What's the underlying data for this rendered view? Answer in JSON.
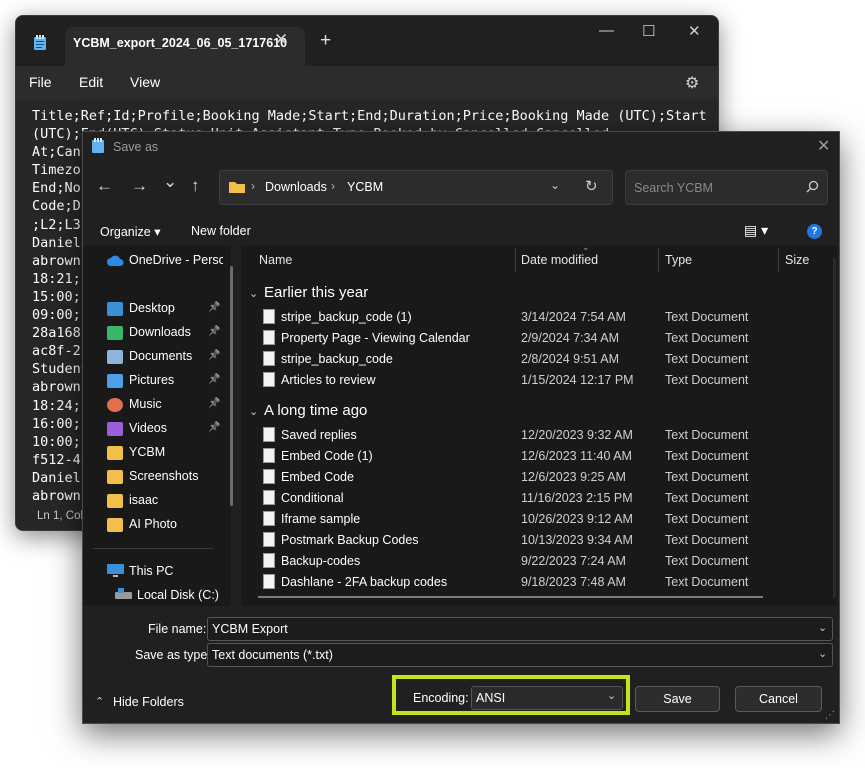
{
  "notepad": {
    "tab_title": "YCBM_export_2024_06_05_1717610",
    "tab_close": "✕",
    "new_tab": "+",
    "window_controls": {
      "minimize": "—",
      "maximize": "☐",
      "close": "✕"
    },
    "menu": [
      "File",
      "Edit",
      "View"
    ],
    "settings_icon": "gear-icon",
    "text_lines": [
      "Title;Ref;Id;Profile;Booking Made;Start;End;Duration;Price;Booking Made (UTC);Start",
      "(UTC);End(UTC);Status;Unit;Assistant;Type;Booked by;Cancelled;Cancelled",
      "At;Canc",
      "Timezo",
      "End;No",
      "Code;D",
      ";L2;L3",
      "Daniel",
      "abrown",
      "18:21;",
      "15:00;",
      "09:00;",
      "28a168",
      "ac8f-2",
      "Student",
      "abrown",
      "18:24;",
      "16:00;",
      "10:00;",
      "f512-4",
      "Daniel",
      "abrown"
    ],
    "status": "Ln 1, Col"
  },
  "dialog": {
    "title": "Save as",
    "close": "✕",
    "nav": {
      "back": "←",
      "forward": "→",
      "recent": "⌄",
      "up": "↑"
    },
    "breadcrumb": [
      "Downloads",
      "YCBM"
    ],
    "breadcrumb_sep": "›",
    "refresh": "↻",
    "search_placeholder": "Search YCBM",
    "toolbar": {
      "organize": "Organize ▾",
      "new_folder": "New folder",
      "view": "▤ ▾",
      "help": "?"
    },
    "sidebar": {
      "onedrive": "OneDrive - Person",
      "quick": [
        {
          "label": "Desktop",
          "pinned": true,
          "icon": "desktop-icon",
          "color": "#3a8fd9"
        },
        {
          "label": "Downloads",
          "pinned": true,
          "icon": "download-icon",
          "color": "#3ab56a"
        },
        {
          "label": "Documents",
          "pinned": true,
          "icon": "documents-icon",
          "color": "#8fb4d9"
        },
        {
          "label": "Pictures",
          "pinned": true,
          "icon": "pictures-icon",
          "color": "#4ea0e6"
        },
        {
          "label": "Music",
          "pinned": true,
          "icon": "music-icon",
          "color": "#e07050"
        },
        {
          "label": "Videos",
          "pinned": true,
          "icon": "videos-icon",
          "color": "#9a60d8"
        },
        {
          "label": "YCBM",
          "pinned": false,
          "icon": "folder-icon",
          "color": "#f2c04a"
        },
        {
          "label": "Screenshots",
          "pinned": false,
          "icon": "folder-icon",
          "color": "#f2c04a"
        },
        {
          "label": "isaac",
          "pinned": false,
          "icon": "folder-icon",
          "color": "#f2c04a"
        },
        {
          "label": "AI Photo",
          "pinned": false,
          "icon": "folder-icon",
          "color": "#f2c04a"
        }
      ],
      "this_pc": "This PC",
      "local_disk": "Local Disk (C:)"
    },
    "columns": {
      "name": "Name",
      "date": "Date modified",
      "type": "Type",
      "size": "Size"
    },
    "groups": [
      {
        "label": "Earlier this year",
        "files": [
          {
            "name": "stripe_backup_code (1)",
            "date": "3/14/2024 7:54 AM",
            "type": "Text Document"
          },
          {
            "name": "Property Page - Viewing Calendar",
            "date": "2/9/2024 7:34 AM",
            "type": "Text Document"
          },
          {
            "name": "stripe_backup_code",
            "date": "2/8/2024 9:51 AM",
            "type": "Text Document"
          },
          {
            "name": "Articles to review",
            "date": "1/15/2024 12:17 PM",
            "type": "Text Document"
          }
        ]
      },
      {
        "label": "A long time ago",
        "files": [
          {
            "name": "Saved replies",
            "date": "12/20/2023 9:32 AM",
            "type": "Text Document"
          },
          {
            "name": "Embed Code (1)",
            "date": "12/6/2023 11:40 AM",
            "type": "Text Document"
          },
          {
            "name": "Embed Code",
            "date": "12/6/2023 9:25 AM",
            "type": "Text Document"
          },
          {
            "name": "Conditional",
            "date": "11/16/2023 2:15 PM",
            "type": "Text Document"
          },
          {
            "name": "Iframe sample",
            "date": "10/26/2023 9:12 AM",
            "type": "Text Document"
          },
          {
            "name": "Postmark Backup Codes",
            "date": "10/13/2023 9:34 AM",
            "type": "Text Document"
          },
          {
            "name": "Backup-codes",
            "date": "9/22/2023 7:24 AM",
            "type": "Text Document"
          },
          {
            "name": "Dashlane - 2FA backup codes",
            "date": "9/18/2023 7:48 AM",
            "type": "Text Document"
          }
        ]
      }
    ],
    "file_name_label": "File name:",
    "file_name_value": "YCBM Export",
    "save_type_label": "Save as type:",
    "save_type_value": "Text documents (*.txt)",
    "hide_folders": "Hide Folders",
    "encoding_label": "Encoding:",
    "encoding_value": "ANSI",
    "save": "Save",
    "cancel": "Cancel",
    "highlight_color": "#c4e31b"
  }
}
